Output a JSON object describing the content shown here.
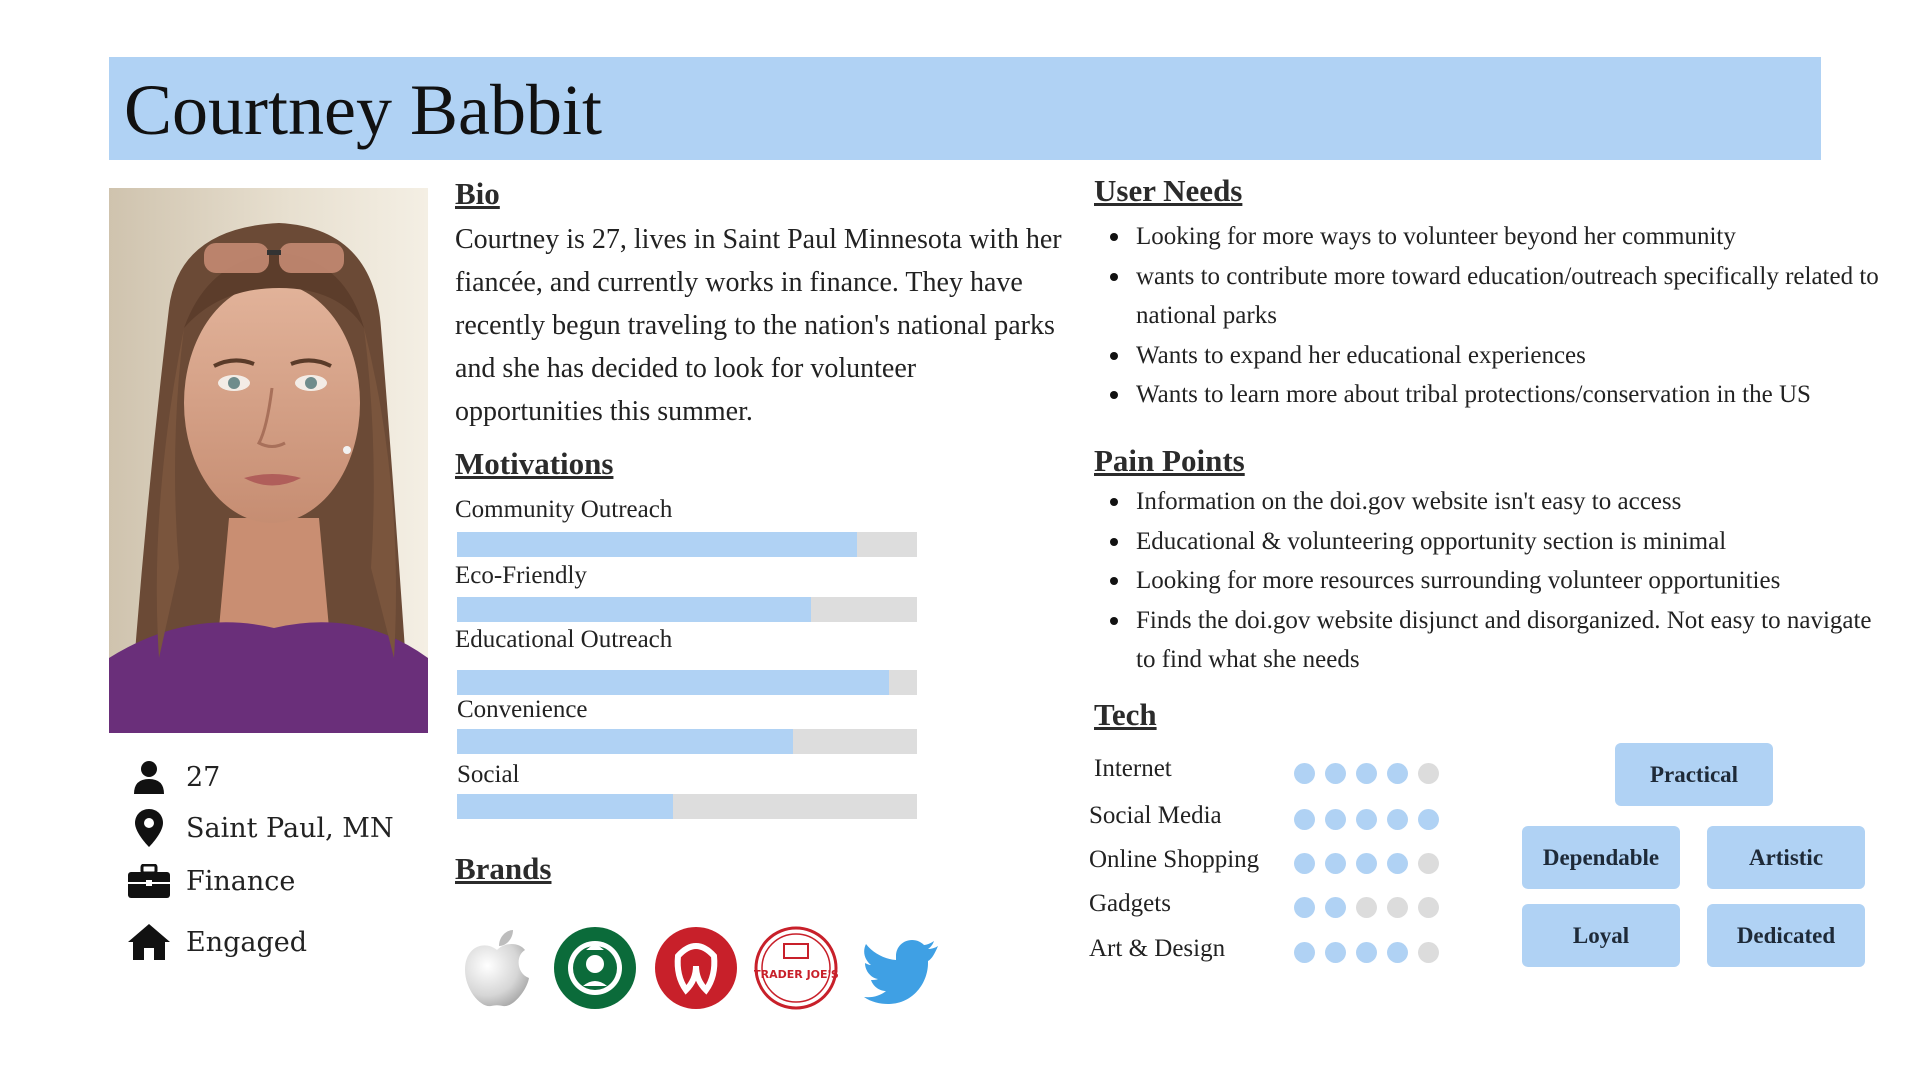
{
  "persona": {
    "name": "Courtney Babbit"
  },
  "demographics": {
    "age": "27",
    "location": "Saint Paul, MN",
    "occupation": "Finance",
    "status": "Engaged"
  },
  "bio": {
    "heading": "Bio",
    "text": "Courtney is 27, lives in Saint Paul Minnesota with her fiancée, and currently works in finance. They have recently begun traveling to the nation's national parks and she has decided to look for volunteer opportunities this summer."
  },
  "motivations": {
    "heading": "Motivations",
    "items": [
      {
        "label": "Community Outreach",
        "level": 0.87
      },
      {
        "label": "Eco-Friendly",
        "level": 0.77
      },
      {
        "label": "Educational Outreach",
        "level": 0.94
      },
      {
        "label": "Convenience",
        "level": 0.73
      },
      {
        "label": "Social",
        "level": 0.47
      }
    ]
  },
  "brands": {
    "heading": "Brands",
    "items": [
      {
        "name": "apple-logo"
      },
      {
        "name": "starbucks-logo"
      },
      {
        "name": "lululemon-logo"
      },
      {
        "name": "trader-joes-logo",
        "text": "TRADER JOE'S"
      },
      {
        "name": "twitter-logo"
      }
    ]
  },
  "user_needs": {
    "heading": "User Needs",
    "items": [
      "Looking for more ways to volunteer beyond her community",
      "wants to contribute more toward education/outreach specifically related to national parks",
      "Wants to expand her educational experiences",
      "Wants to learn more about tribal protections/conservation in the US"
    ]
  },
  "pain_points": {
    "heading": "Pain Points",
    "items": [
      "Information on the doi.gov website isn't easy to access",
      "Educational & volunteering opportunity section is minimal",
      "Looking for more resources surrounding volunteer opportunities",
      "Finds the doi.gov website disjunct and disorganized. Not easy to navigate to find what she needs"
    ]
  },
  "tech": {
    "heading": "Tech",
    "items": [
      {
        "label": "Internet",
        "rating": 4,
        "max": 5
      },
      {
        "label": "Social Media",
        "rating": 5,
        "max": 5
      },
      {
        "label": "Online Shopping",
        "rating": 4,
        "max": 5
      },
      {
        "label": "Gadgets",
        "rating": 2,
        "max": 5
      },
      {
        "label": "Art & Design",
        "rating": 4,
        "max": 5
      }
    ]
  },
  "traits": [
    "Practical",
    "Dependable",
    "Artistic",
    "Loyal",
    "Dedicated"
  ],
  "colors": {
    "accent": "#b0d2f4",
    "track": "#dddddd",
    "dot_off": "#dcdcdc"
  }
}
